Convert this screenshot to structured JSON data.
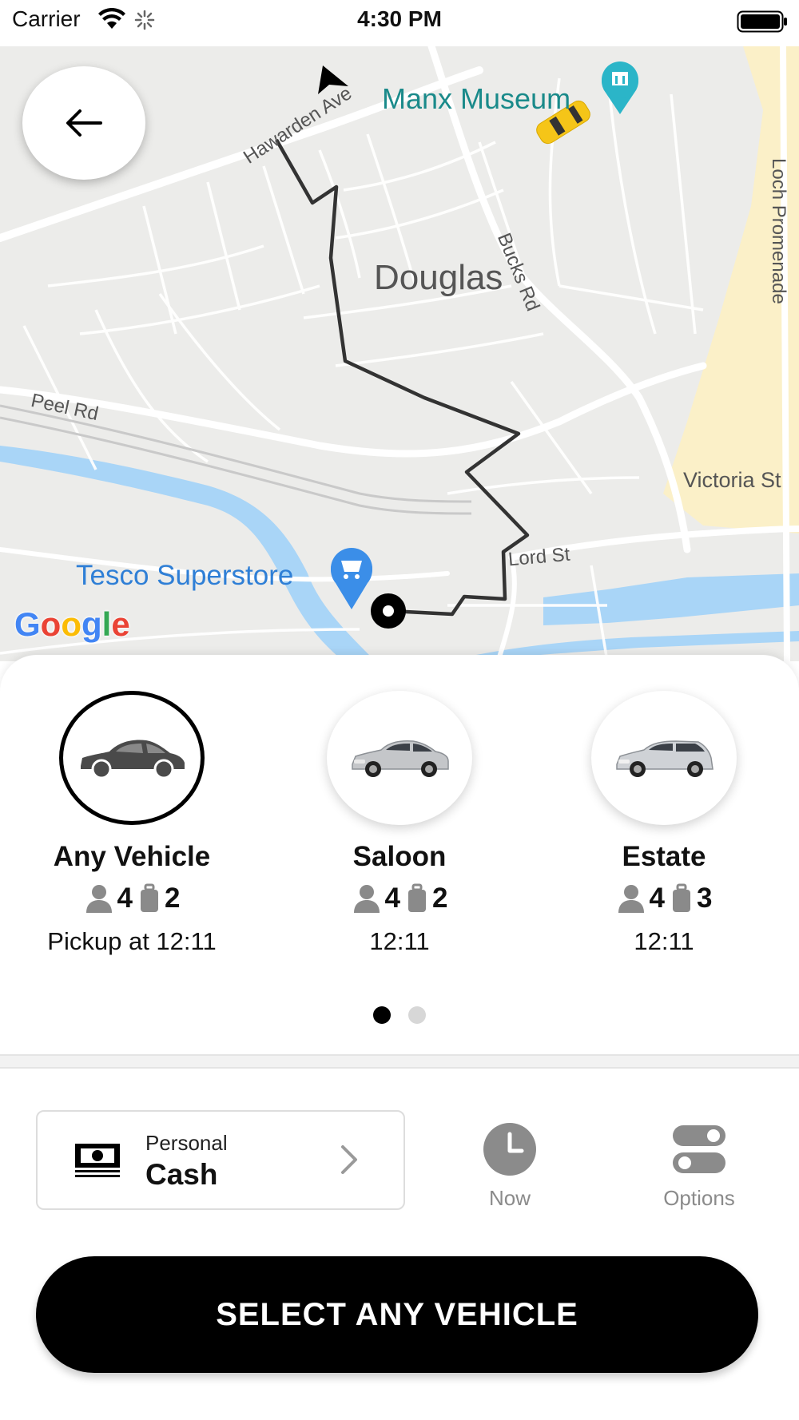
{
  "status_bar": {
    "carrier": "Carrier",
    "time": "4:30 PM"
  },
  "map": {
    "labels": {
      "douglas": "Douglas",
      "manx_museum": "Manx Museum",
      "tesco": "Tesco Superstore",
      "victoria_st": "Victoria St",
      "lord_st": "Lord St",
      "peel_rd": "Peel Rd",
      "hawarden_ave": "Hawarden Ave",
      "bucks_rd": "Bucks Rd",
      "loch_promenade": "Loch Promenade"
    },
    "attribution": [
      "G",
      "o",
      "o",
      "g",
      "l",
      "e"
    ],
    "attribution_colors": [
      "#4285F4",
      "#EA4335",
      "#FBBC05",
      "#4285F4",
      "#34A853",
      "#EA4335"
    ],
    "colors": {
      "route": "#333333",
      "water": "#a9d5f7",
      "commercial": "#fbf0c8",
      "road": "#ffffff",
      "poi_museum": "#2bb5c8",
      "poi_shop": "#3b8ee8",
      "taxi": "#f5c518"
    }
  },
  "vehicles": [
    {
      "name": "Any Vehicle",
      "passengers": "4",
      "luggage": "2",
      "pickup": "Pickup at  12:11",
      "selected": true,
      "icon": "car-silhouette-icon"
    },
    {
      "name": "Saloon",
      "passengers": "4",
      "luggage": "2",
      "pickup": "12:11",
      "selected": false,
      "icon": "saloon-car-icon"
    },
    {
      "name": "Estate",
      "passengers": "4",
      "luggage": "3",
      "pickup": "12:11",
      "selected": false,
      "icon": "estate-car-icon"
    }
  ],
  "pager": {
    "pages": 2,
    "current": 1
  },
  "payment": {
    "type": "Personal",
    "method": "Cash",
    "icon": "cash-icon"
  },
  "controls": {
    "time_label": "Now",
    "options_label": "Options"
  },
  "select_button": "SELECT ANY VEHICLE"
}
